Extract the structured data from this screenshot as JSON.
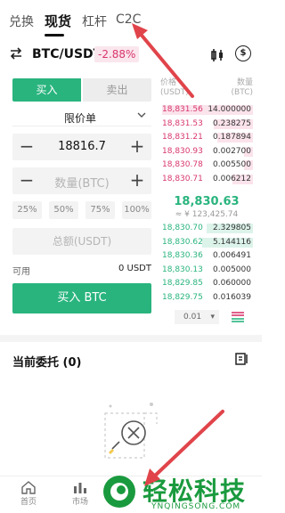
{
  "tabs": [
    {
      "label": "兑换",
      "active": false
    },
    {
      "label": "现货",
      "active": true
    },
    {
      "label": "杠杆",
      "active": false
    },
    {
      "label": "C2C",
      "active": false
    }
  ],
  "pair": {
    "name": "BTC/USDT",
    "change": "-2.88%",
    "swap_icon": "swap-arrows-icon",
    "chart_icon": "candlestick-icon",
    "coin_icon": "dollar-coin-icon"
  },
  "trade": {
    "buy_label": "买入",
    "sell_label": "卖出",
    "order_type": "限价单",
    "price_value": "18816.7",
    "amount_placeholder": "数量(BTC)",
    "percentages": [
      "25%",
      "50%",
      "75%",
      "100%"
    ],
    "total_placeholder": "总额(USDT)",
    "available_label": "可用",
    "available_value": "0 USDT",
    "submit_label": "买入 BTC"
  },
  "orderbook": {
    "price_header": "价格\n(USDT)",
    "qty_header": "数量\n(BTC)",
    "asks": [
      {
        "price": "18,831.56",
        "qty": "14.000000",
        "depth": 0.98
      },
      {
        "price": "18,831.53",
        "qty": "0.238275",
        "depth": 0.42
      },
      {
        "price": "18,831.21",
        "qty": "0.187894",
        "depth": 0.38
      },
      {
        "price": "18,830.93",
        "qty": "0.002700",
        "depth": 0.1
      },
      {
        "price": "18,830.78",
        "qty": "0.005500",
        "depth": 0.1
      },
      {
        "price": "18,830.71",
        "qty": "0.006212",
        "depth": 0.22
      }
    ],
    "last_price": "18,830.63",
    "last_price_fiat": "≈ ¥ 123,425.74",
    "bids": [
      {
        "price": "18,830.70",
        "qty": "2.329805",
        "depth": 0.5
      },
      {
        "price": "18,830.62",
        "qty": "5.144116",
        "depth": 0.55
      },
      {
        "price": "18,830.36",
        "qty": "0.006491",
        "depth": 0.0
      },
      {
        "price": "18,830.13",
        "qty": "0.005000",
        "depth": 0.0
      },
      {
        "price": "18,829.85",
        "qty": "0.060000",
        "depth": 0.0
      },
      {
        "price": "18,829.75",
        "qty": "0.016039",
        "depth": 0.0
      }
    ],
    "precision": "0.01"
  },
  "orders": {
    "title": "当前委托 (0)",
    "icon": "order-history-icon",
    "empty_icon": "empty-document-icon"
  },
  "nav": [
    {
      "label": "首页",
      "icon": "home-icon"
    },
    {
      "label": "市场",
      "icon": "market-bars-icon"
    }
  ],
  "watermark": {
    "text": "轻松科技",
    "sub": "YNQINGSONG.COM"
  },
  "colors": {
    "green": "#29b47e",
    "red": "#d8366d",
    "annotation_arrow": "#e0444a"
  }
}
